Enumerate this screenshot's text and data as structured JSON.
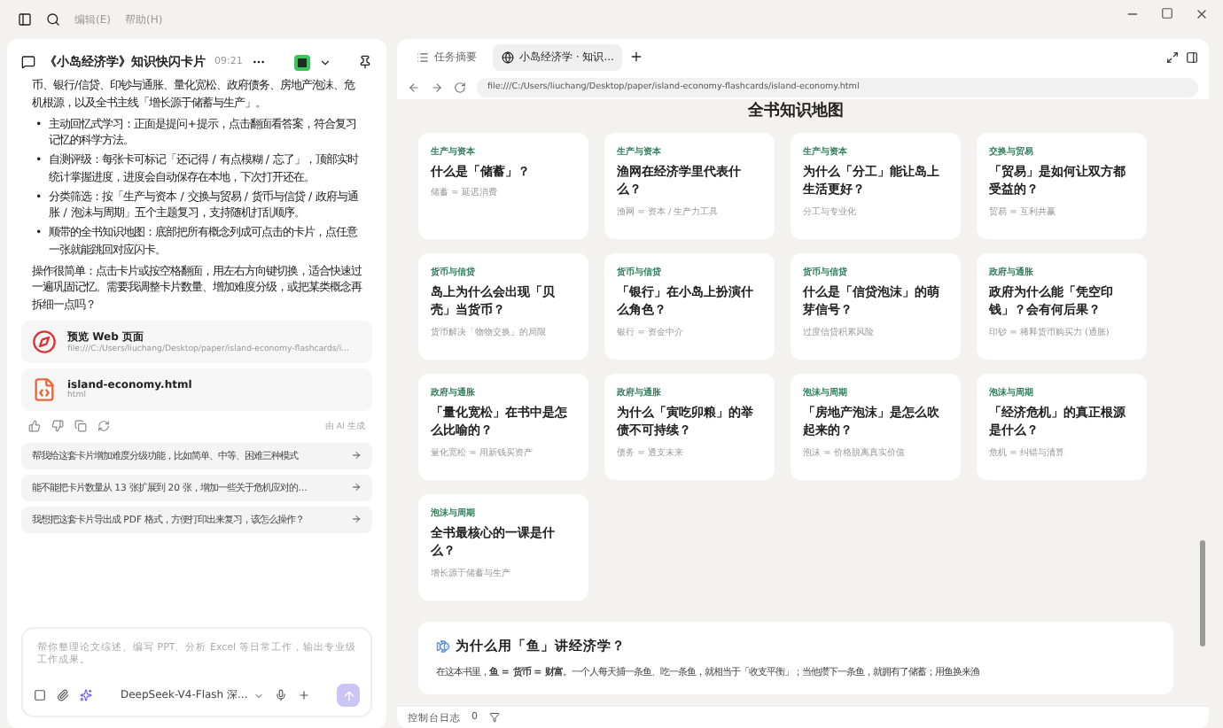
{
  "menu": [
    "编辑(E)",
    "帮助(H)"
  ],
  "chat": {
    "title": "《小岛经济学》知识快闪卡片",
    "time": "09:21",
    "paragraph_top": "币、银行/信贷、印钞与通胀、量化宽松、政府债务、房地产泡沫、危机根源，以及全书主线「增长源于储蓄与生产」。",
    "bullets": [
      {
        "marker": "•",
        "text": "主动回忆式学习：正面是提问+提示，点击翻面看答案，符合复习记忆的科学方法。"
      },
      {
        "marker": "•",
        "text": "自测评级：每张卡可标记「还记得 / 有点模糊 / 忘了」，顶部实时统计掌握进度，进度会自动保存在本地，下次打开还在。"
      },
      {
        "marker": "•",
        "text": "分类筛选：按「生产与资本 / 交换与贸易 / 货币与信贷 / 政府与通胀 / 泡沫与周期」五个主题复习，支持随机打乱顺序。"
      },
      {
        "marker": "•",
        "text": "顺带的全书知识地图：底部把所有概念列成可点击的卡片，点任意一张就能跳回对应闪卡。"
      }
    ],
    "paragraph_bottom": "操作很简单：点击卡片或按空格翻面，用左右方向键切换，适合快速过一遍巩固记忆。需要我调整卡片数量、增加难度分级，或把某类概念再拆细一点吗？",
    "attachments": [
      {
        "kind": "web",
        "title": "预览 Web 页面",
        "subtitle": "file:///C:/Users/liuchang/Desktop/paper/island-economy-flashcards/i..."
      },
      {
        "kind": "file",
        "title": "island-economy.html",
        "subtitle": "html"
      }
    ],
    "generated_note": "由 AI 生成",
    "suggestions": [
      "帮我给这套卡片增加难度分级功能，比如简单、中等、困难三种模式",
      "能不能把卡片数量从 13 张扩展到 20 张，增加一些关于危机应对的...",
      "我想把这套卡片导出成 PDF 格式，方便打印出来复习，该怎么操作？"
    ],
    "input": {
      "placeholder": "帮你整理论文综述、编写 PPT、分析 Excel 等日常工作，输出专业级工作成果。"
    },
    "model": "DeepSeek-V4-Flash 深..."
  },
  "browser": {
    "tabs": [
      {
        "label": "任务摘要",
        "selected": false
      },
      {
        "label": "小岛经济学 · 知识...",
        "selected": true
      }
    ],
    "url": "file:///C:/Users/liuchang/Desktop/paper/island-economy-flashcards/island-economy.html",
    "page": {
      "heading": "全书知识地图",
      "cards": [
        {
          "category": "生产与资本",
          "question": "什么是「储蓄」？",
          "answer": "储蓄 = 延迟消费"
        },
        {
          "category": "生产与资本",
          "question": "渔网在经济学里代表什么？",
          "answer": "渔网 = 资本 / 生产力工具"
        },
        {
          "category": "生产与资本",
          "question": "为什么「分工」能让岛上生活更好？",
          "answer": "分工与专业化"
        },
        {
          "category": "交换与贸易",
          "question": "「贸易」是如何让双方都受益的？",
          "answer": "贸易 = 互利共赢"
        },
        {
          "category": "货币与信贷",
          "question": "岛上为什么会出现「贝壳」当货币？",
          "answer": "货币解决「物物交换」的局限"
        },
        {
          "category": "货币与信贷",
          "question": "「银行」在小岛上扮演什么角色？",
          "answer": "银行 = 资金中介"
        },
        {
          "category": "货币与信贷",
          "question": "什么是「信贷泡沫」的萌芽信号？",
          "answer": "过度信贷积累风险"
        },
        {
          "category": "政府与通胀",
          "question": "政府为什么能「凭空印钱」？会有何后果？",
          "answer": "印钞 = 稀释货币购买力 (通胀)"
        },
        {
          "category": "政府与通胀",
          "question": "「量化宽松」在书中是怎么比喻的？",
          "answer": "量化宽松 = 用新钱买资产"
        },
        {
          "category": "政府与通胀",
          "question": "为什么「寅吃卯粮」的举债不可持续？",
          "answer": "债务 = 透支未来"
        },
        {
          "category": "泡沫与周期",
          "question": "「房地产泡沫」是怎么吹起来的？",
          "answer": "泡沫 = 价格脱离真实价值"
        },
        {
          "category": "泡沫与周期",
          "question": "「经济危机」的真正根源是什么？",
          "answer": "危机 = 纠错与清算"
        },
        {
          "category": "泡沫与周期",
          "question": "全书最核心的一课是什么？",
          "answer": "增长源于储蓄与生产"
        }
      ],
      "section": {
        "title": "为什么用「鱼」讲经济学？",
        "body": "在这本书里，**鱼 = 货币 = 财富**。一个人每天捕一条鱼、吃一条鱼，就相当于「收支平衡」；当他攒下一条鱼，就拥有了储蓄；用鱼换来渔"
      }
    }
  },
  "status_bar": {
    "label": "控制台日志",
    "count": "0"
  }
}
